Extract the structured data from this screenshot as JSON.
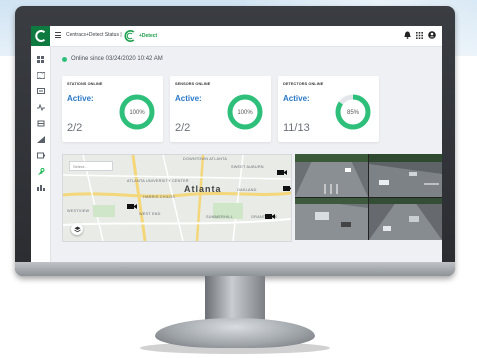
{
  "header": {
    "title": "Centracs+Detect Status |",
    "brand": "+Detect"
  },
  "sidebar": {
    "items": [
      "dashboard-icon",
      "map-icon",
      "monitor-icon",
      "signal-icon",
      "intersection-icon",
      "chart-icon",
      "device-icon",
      "detector-icon",
      "report-icon"
    ],
    "active": "detector-icon"
  },
  "status": {
    "text": "Online since 03/24/2020 10:42 AM"
  },
  "cards": [
    {
      "label": "STATIONS ONLINE",
      "active": "Active:",
      "count": "2/2",
      "percent_text": "100%",
      "percent": 100
    },
    {
      "label": "SENSORS ONLINE",
      "active": "Active:",
      "count": "2/2",
      "percent_text": "100%",
      "percent": 100
    },
    {
      "label": "DETECTORS ONLINE",
      "active": "Active:",
      "count": "11/13",
      "percent_text": "85%",
      "percent": 85
    }
  ],
  "map": {
    "select_placeholder": "Select...",
    "city": "Atlanta",
    "labels": [
      "DOWNTOWN ATLANTA",
      "SWEET AUBURN",
      "ATLANTA UNIVERSITY CENTER",
      "OAKLAND",
      "HARRIS CHILDS",
      "WEST END",
      "WESTVIEW",
      "SUMMERHILL",
      "GRANT PARK"
    ]
  },
  "colors": {
    "accent": "#2ec07a",
    "active_text": "#2a78c8",
    "ring_track": "#e3e6ea",
    "brand_green": "#0f7a3f"
  }
}
